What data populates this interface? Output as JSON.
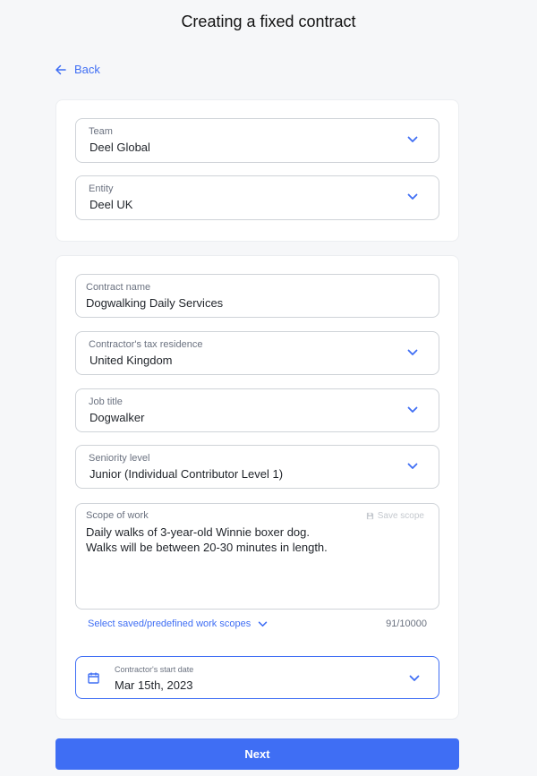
{
  "header": {
    "title": "Creating a fixed contract"
  },
  "nav": {
    "back_label": "Back"
  },
  "team_card": {
    "team": {
      "label": "Team",
      "value": "Deel Global"
    },
    "entity": {
      "label": "Entity",
      "value": "Deel UK"
    }
  },
  "contract_card": {
    "contract_name": {
      "label": "Contract name",
      "value": "Dogwalking Daily Services"
    },
    "tax_residence": {
      "label": "Contractor's tax residence",
      "value": "United Kingdom"
    },
    "job_title": {
      "label": "Job title",
      "value": "Dogwalker"
    },
    "seniority": {
      "label": "Seniority level",
      "value": "Junior (Individual Contributor Level 1)"
    },
    "scope": {
      "label": "Scope of work",
      "save_label": "Save scope",
      "value": "Daily walks of 3-year-old Winnie boxer dog.\nWalks will be between 20-30 minutes in length."
    },
    "predefined_scopes_label": "Select saved/predefined work scopes",
    "char_counter": "91/10000",
    "start_date": {
      "label": "Contractor's start date",
      "value": "Mar 15th, 2023"
    }
  },
  "footer": {
    "next_label": "Next"
  },
  "colors": {
    "accent": "#3f6ef4",
    "background": "#f6f7f9",
    "border": "#cfd3d8"
  },
  "icons": {
    "back": "arrow-left-icon",
    "dropdown": "chevron-down-icon",
    "save": "floppy-disk-icon",
    "date": "calendar-icon"
  }
}
